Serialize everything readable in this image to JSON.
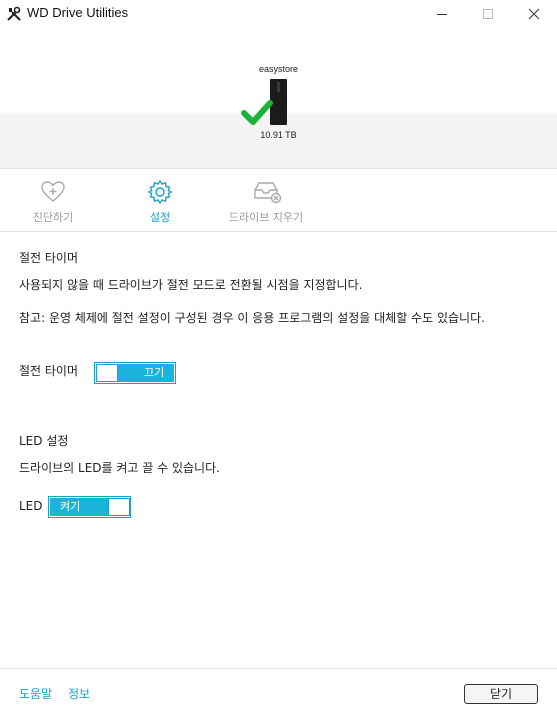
{
  "window": {
    "title": "WD Drive Utilities",
    "min_icon": "minimize-icon",
    "max_icon": "maximize-icon",
    "close_icon": "close-icon"
  },
  "device": {
    "name": "easystore",
    "capacity": "10.91 TB",
    "status_icon": "check-icon"
  },
  "tabs": [
    {
      "label": "진단하기",
      "icon": "heart-pulse-icon",
      "active": false
    },
    {
      "label": "설정",
      "icon": "gear-icon",
      "active": true
    },
    {
      "label": "드라이브 지우기",
      "icon": "drive-erase-icon",
      "active": false
    }
  ],
  "sleep": {
    "title": "절전 타이머",
    "desc": "사용되지 않을 때 드라이브가 절전 모드로 전환될 시점을 지정합니다.",
    "note": "참고: 운영 체제에 절전 설정이 구성된 경우 이 응용 프로그램의 설정을 대체할 수도 있습니다.",
    "toggle_label": "절전 타이머",
    "toggle_value": "끄기"
  },
  "led": {
    "title": "LED 설정",
    "desc": "드라이브의 LED를 켜고 끌 수 있습니다.",
    "toggle_label": "LED",
    "toggle_value": "켜기"
  },
  "footer": {
    "help": "도움말",
    "info": "정보",
    "close": "닫기"
  },
  "colors": {
    "accent": "#1ab3d9",
    "accent_text": "#1aa1c8",
    "check": "#1db33a"
  }
}
